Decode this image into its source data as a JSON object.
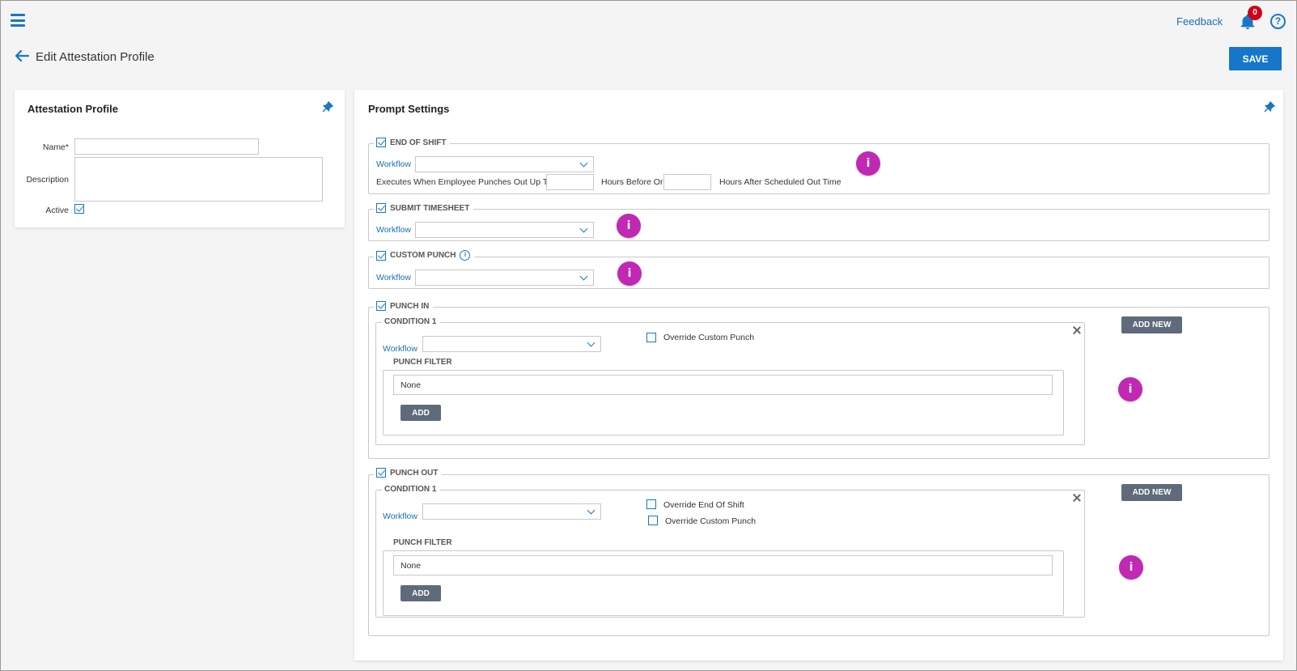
{
  "header": {
    "feedback": "Feedback",
    "notification_count": "0",
    "help_glyph": "?",
    "icons": {
      "menu": "hamburger-icon",
      "bell": "bell-icon",
      "help": "help-icon"
    }
  },
  "page": {
    "title": "Edit Attestation Profile",
    "save_label": "SAVE"
  },
  "profile_card": {
    "title": "Attestation Profile",
    "name_label": "Name*",
    "description_label": "Description",
    "active_label": "Active",
    "name_value": "",
    "description_value": "",
    "active": true
  },
  "prompt_card": {
    "title": "Prompt Settings",
    "info_glyph": "i",
    "workflow_label": "Workflow",
    "end_of_shift": {
      "label": "END OF SHIFT",
      "checked": true,
      "executes_text": "Executes When Employee Punches Out Up To",
      "hours_before_text": "Hours Before Or",
      "hours_after_text": "Hours After Scheduled Out Time",
      "hours_before_value": "",
      "hours_after_value": ""
    },
    "submit_timesheet": {
      "label": "SUBMIT TIMESHEET",
      "checked": true
    },
    "custom_punch": {
      "label": "CUSTOM PUNCH",
      "checked": true
    },
    "punch_in": {
      "label": "PUNCH IN",
      "checked": true,
      "add_new_label": "ADD NEW",
      "condition_label": "CONDITION 1",
      "override_custom_punch": "Override Custom Punch",
      "punch_filter_label": "PUNCH FILTER",
      "filter_value": "None",
      "add_label": "ADD"
    },
    "punch_out": {
      "label": "PUNCH OUT",
      "checked": true,
      "add_new_label": "ADD NEW",
      "condition_label": "CONDITION 1",
      "override_end_of_shift": "Override End Of Shift",
      "override_custom_punch": "Override Custom Punch",
      "punch_filter_label": "PUNCH FILTER",
      "filter_value": "None",
      "add_label": "ADD"
    }
  },
  "colors": {
    "accent": "#1677c8",
    "info_dot": "#c128b4",
    "badge": "#d0021b",
    "gray_button": "#5f6b7a"
  }
}
